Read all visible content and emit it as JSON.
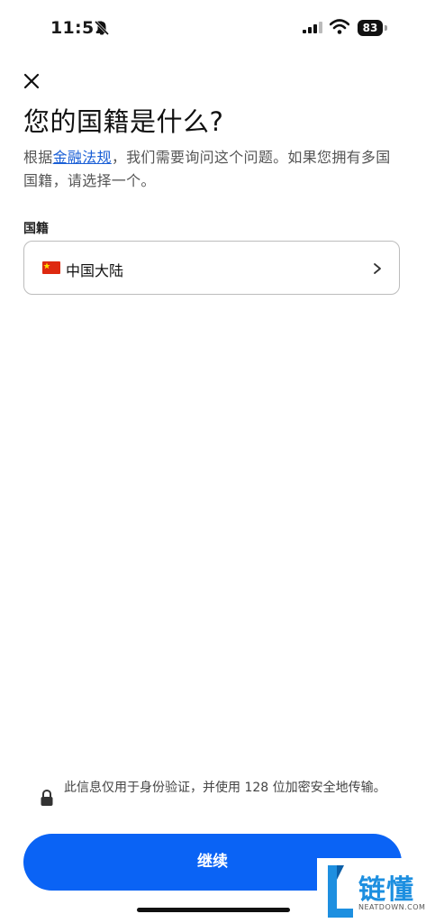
{
  "status_bar": {
    "time": "11:51",
    "battery": "83"
  },
  "header": {
    "title": "您的国籍是什么?"
  },
  "intro": {
    "before_link": "根据",
    "link": "金融法规",
    "after_link": "，我们需要询问这个问题。如果您拥有多国国籍，请选择一个。"
  },
  "nationality": {
    "label": "国籍",
    "value": "中国大陆",
    "flag_icon": "china-flag-icon"
  },
  "footer": {
    "privacy_note": "此信息仅用于身份验证，并使用 128 位加密安全地传输。",
    "continue_label": "继续"
  },
  "watermark": {
    "text": "链懂",
    "sub": "NEATDOWN.COM"
  },
  "colors": {
    "primary": "#0a63f5",
    "link": "#1a5fd6",
    "watermark": "#1d8fe0"
  }
}
